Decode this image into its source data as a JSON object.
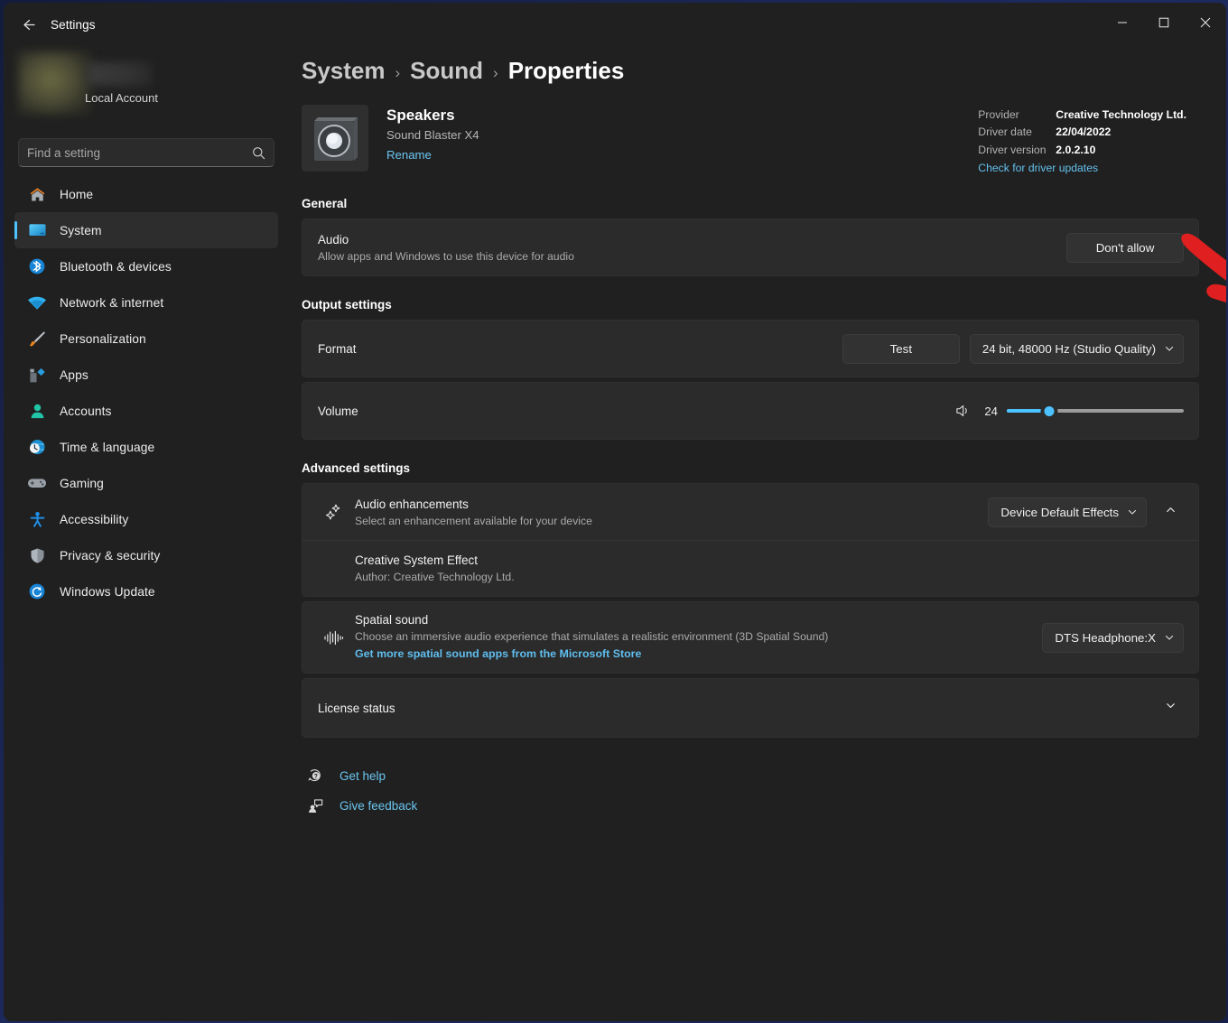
{
  "window": {
    "app_title": "Settings",
    "back_icon": "arrow-left-icon",
    "controls": {
      "minimize": "minimize-icon",
      "maximize": "maximize-icon",
      "close": "close-icon"
    }
  },
  "sidebar": {
    "account_label": "Local Account",
    "search": {
      "placeholder": "Find a setting",
      "value": "",
      "icon": "search-icon"
    },
    "items": [
      {
        "label": "Home",
        "icon": "home-icon",
        "selected": false
      },
      {
        "label": "System",
        "icon": "monitor-icon",
        "selected": true
      },
      {
        "label": "Bluetooth & devices",
        "icon": "bluetooth-icon",
        "selected": false
      },
      {
        "label": "Network & internet",
        "icon": "wifi-icon",
        "selected": false
      },
      {
        "label": "Personalization",
        "icon": "paintbrush-icon",
        "selected": false
      },
      {
        "label": "Apps",
        "icon": "apps-icon",
        "selected": false
      },
      {
        "label": "Accounts",
        "icon": "person-icon",
        "selected": false
      },
      {
        "label": "Time & language",
        "icon": "clock-globe-icon",
        "selected": false
      },
      {
        "label": "Gaming",
        "icon": "gamepad-icon",
        "selected": false
      },
      {
        "label": "Accessibility",
        "icon": "accessibility-icon",
        "selected": false
      },
      {
        "label": "Privacy & security",
        "icon": "shield-icon",
        "selected": false
      },
      {
        "label": "Windows Update",
        "icon": "update-icon",
        "selected": false
      }
    ]
  },
  "breadcrumb": {
    "items": [
      "System",
      "Sound",
      "Properties"
    ],
    "separator": "›"
  },
  "device": {
    "icon": "speaker-icon",
    "name": "Speakers",
    "subtitle": "Sound Blaster X4",
    "rename_label": "Rename"
  },
  "driver": {
    "provider_label": "Provider",
    "provider_value": "Creative Technology Ltd.",
    "date_label": "Driver date",
    "date_value": "22/04/2022",
    "version_label": "Driver version",
    "version_value": "2.0.2.10",
    "update_link": "Check for driver updates"
  },
  "general": {
    "section_title": "General",
    "audio": {
      "title": "Audio",
      "subtitle": "Allow apps and Windows to use this device for audio",
      "button_label": "Don't allow"
    }
  },
  "output": {
    "section_title": "Output settings",
    "format": {
      "title": "Format",
      "test_label": "Test",
      "value": "24 bit, 48000 Hz (Studio Quality)"
    },
    "volume": {
      "title": "Volume",
      "icon": "speaker-wave-icon",
      "value": "24",
      "percent": 24
    }
  },
  "advanced": {
    "section_title": "Advanced settings",
    "enhancements": {
      "icon": "sparkles-icon",
      "title": "Audio enhancements",
      "subtitle": "Select an enhancement available for your device",
      "value": "Device Default Effects",
      "expander_icon": "chevron-up-icon"
    },
    "effect": {
      "title": "Creative System Effect",
      "subtitle": "Author: Creative Technology Ltd."
    },
    "spatial": {
      "icon": "waveform-icon",
      "title": "Spatial sound",
      "subtitle": "Choose an immersive audio experience that simulates a realistic environment (3D Spatial Sound)",
      "link": "Get more spatial sound apps from the Microsoft Store",
      "value": "DTS Headphone:X"
    },
    "license": {
      "title": "License status",
      "expander_icon": "chevron-down-icon"
    }
  },
  "footer": {
    "links": [
      {
        "label": "Get help",
        "icon": "help-icon"
      },
      {
        "label": "Give feedback",
        "icon": "feedback-icon"
      }
    ]
  },
  "annotation": {
    "type": "red-arrow",
    "color": "#e02020",
    "points_to": "Don't allow"
  },
  "colors": {
    "accent": "#4cc2ff",
    "link": "#6ac5ef",
    "card": "#2b2b2b",
    "app_bg": "#202020",
    "annotation": "#e02020"
  }
}
